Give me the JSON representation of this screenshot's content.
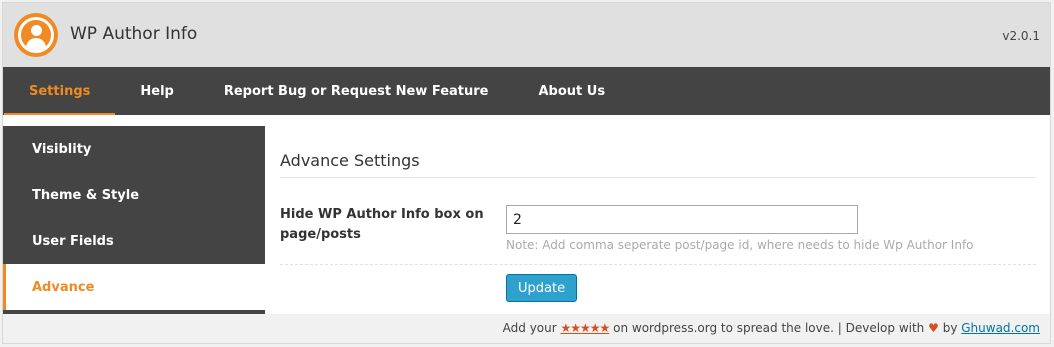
{
  "header": {
    "title": "WP Author Info",
    "version": "v2.0.1",
    "logo_icon": "user-avatar-icon",
    "accent_color": "#f08a24"
  },
  "nav": {
    "tabs": [
      {
        "label": "Settings",
        "active": true
      },
      {
        "label": "Help"
      },
      {
        "label": "Report Bug or Request New Feature"
      },
      {
        "label": "About Us"
      }
    ]
  },
  "sidebar": {
    "items": [
      {
        "label": "Visiblity"
      },
      {
        "label": "Theme & Style"
      },
      {
        "label": "User Fields"
      },
      {
        "label": "Advance",
        "active": true
      }
    ]
  },
  "main": {
    "section_title": "Advance Settings",
    "field_label": "Hide WP Author Info box on page/posts",
    "field_value": "2",
    "field_note": "Note: Add comma seperate post/page id, where needs to hide Wp Author Info",
    "update_label": "Update",
    "button_color": "#2ea2cc"
  },
  "footer": {
    "prefix": "Add your",
    "stars": "★★★★★",
    "middle": "on wordpress.org to spread the love. | Develop with",
    "heart": "♥",
    "by": "by",
    "link": "Ghuwad.com"
  }
}
